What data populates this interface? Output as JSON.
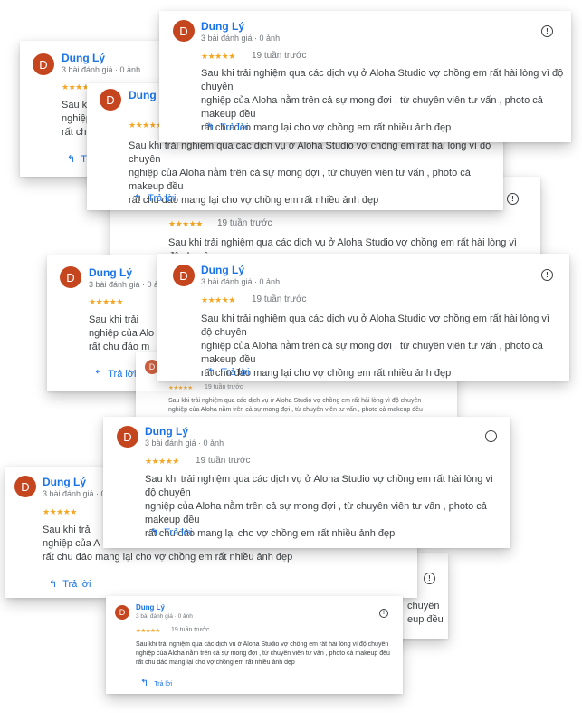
{
  "review": {
    "avatar_letter": "D",
    "author": "Dung Lý",
    "meta": "3 bài đánh giá · 0 ảnh",
    "stars": "★★★★★",
    "rating": 5,
    "time": "19 tuần trước",
    "text": "Sau khi trải nghiệm qua các dịch vụ ở Aloha Studio vợ chồng em rất hài lòng vì độ chuyên nghiệp của Aloha nằm trên cả sự mong đợi , từ chuyên viên tư vấn , photo cả makeup đều rất chu đáo mang lại cho vợ chồng em rất nhiều ảnh đẹp",
    "reply_label": "Trả lời",
    "reply_icon": "reply-arrow-icon",
    "flag_icon": "report-info-icon"
  },
  "fragments": {
    "line1": "Sau khi trải nghiệm qua các dịch vụ ở Aloha Studio vợ chồng em rất hài lòng vì độ chuyên",
    "line2": "nghiệp của Aloha nằm trên cả sự mong đợi , từ chuyên viên tư vấn , photo cả makeup đều",
    "line3": "rất chu đáo mang lại cho vợ chồng em rất nhiều ảnh đẹp",
    "frag_a": "Sau kh",
    "frag_b": "nghiệp",
    "frag_c": "rất chu",
    "frag_d": "Sau khi trải",
    "frag_e": "nghiệp của Alo",
    "frag_f": "vì độ chuyên",
    "frag_g": "p cả makeup đều",
    "frag_h": "chuyên",
    "frag_i": "eup đều",
    "frag_j": "Sau khi trải nghiệm qua",
    "frag_k": "Sau khi trả",
    "frag_l": "nghiệp của A",
    "frag_m": "rất chu đáo m",
    "meta_short": "3 bài đánh giá · 0",
    "meta_short2": "3 bài đánh giá · 0 ả"
  }
}
